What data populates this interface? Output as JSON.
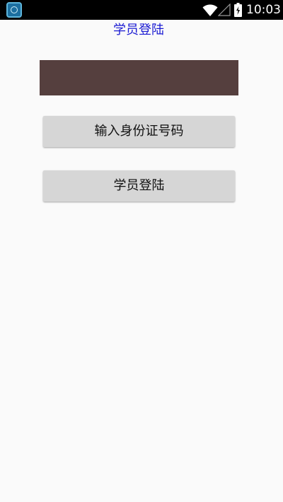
{
  "status_bar": {
    "time": "10:03",
    "icons": [
      "app-icon",
      "wifi-icon",
      "signal-icon",
      "battery-icon"
    ]
  },
  "header": {
    "title": "学员登陆"
  },
  "form": {
    "id_field": {
      "value": "",
      "placeholder": ""
    },
    "enter_id_button": "输入身份证号码",
    "login_button": "学员登陆"
  },
  "colors": {
    "status_bar": "#000000",
    "background": "#fafafa",
    "title": "#1a1ad2",
    "input_field": "#553f3e",
    "button": "#d6d6d6"
  }
}
